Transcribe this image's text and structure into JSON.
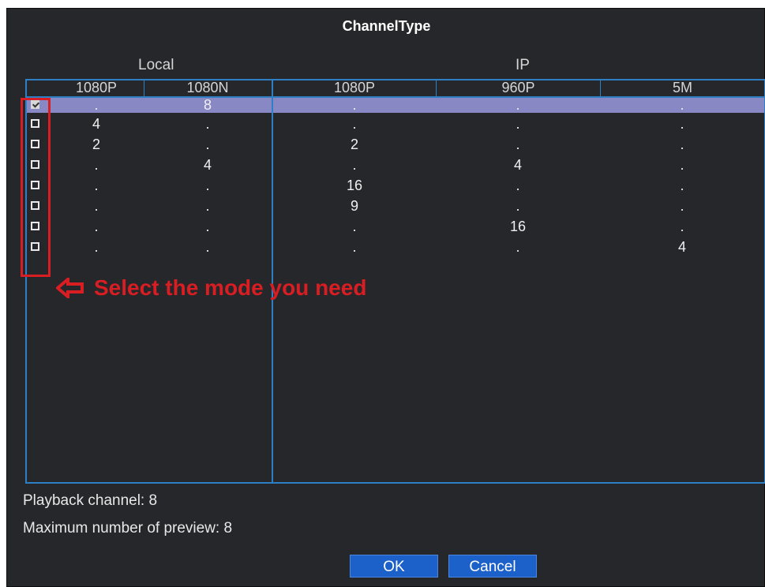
{
  "dialog": {
    "title": "ChannelType",
    "groups": {
      "local": "Local",
      "ip": "IP"
    },
    "columns": [
      "1080P",
      "1080N",
      "1080P",
      "960P",
      "5M"
    ],
    "rows": [
      {
        "checked": true,
        "values": [
          ".",
          "8",
          ".",
          ".",
          "."
        ]
      },
      {
        "checked": false,
        "values": [
          "4",
          ".",
          ".",
          ".",
          "."
        ]
      },
      {
        "checked": false,
        "values": [
          "2",
          ".",
          "2",
          ".",
          "."
        ]
      },
      {
        "checked": false,
        "values": [
          ".",
          "4",
          ".",
          "4",
          "."
        ]
      },
      {
        "checked": false,
        "values": [
          ".",
          ".",
          "16",
          ".",
          "."
        ]
      },
      {
        "checked": false,
        "values": [
          ".",
          ".",
          "9",
          ".",
          "."
        ]
      },
      {
        "checked": false,
        "values": [
          ".",
          ".",
          ".",
          "16",
          "."
        ]
      },
      {
        "checked": false,
        "values": [
          ".",
          ".",
          ".",
          ".",
          "4"
        ]
      }
    ],
    "annotation": "Select the mode you need",
    "playback_channel": "Playback channel: 8",
    "max_preview": "Maximum number of preview: 8",
    "ok_label": "OK",
    "cancel_label": "Cancel"
  },
  "colors": {
    "background": "#26272b",
    "grid_line": "#2f7fc4",
    "selected_row": "#8888c4",
    "annotation_red": "#d81e23",
    "button": "#1c61c9"
  },
  "icons": {
    "annotation_arrow": "left-arrow-icon"
  }
}
